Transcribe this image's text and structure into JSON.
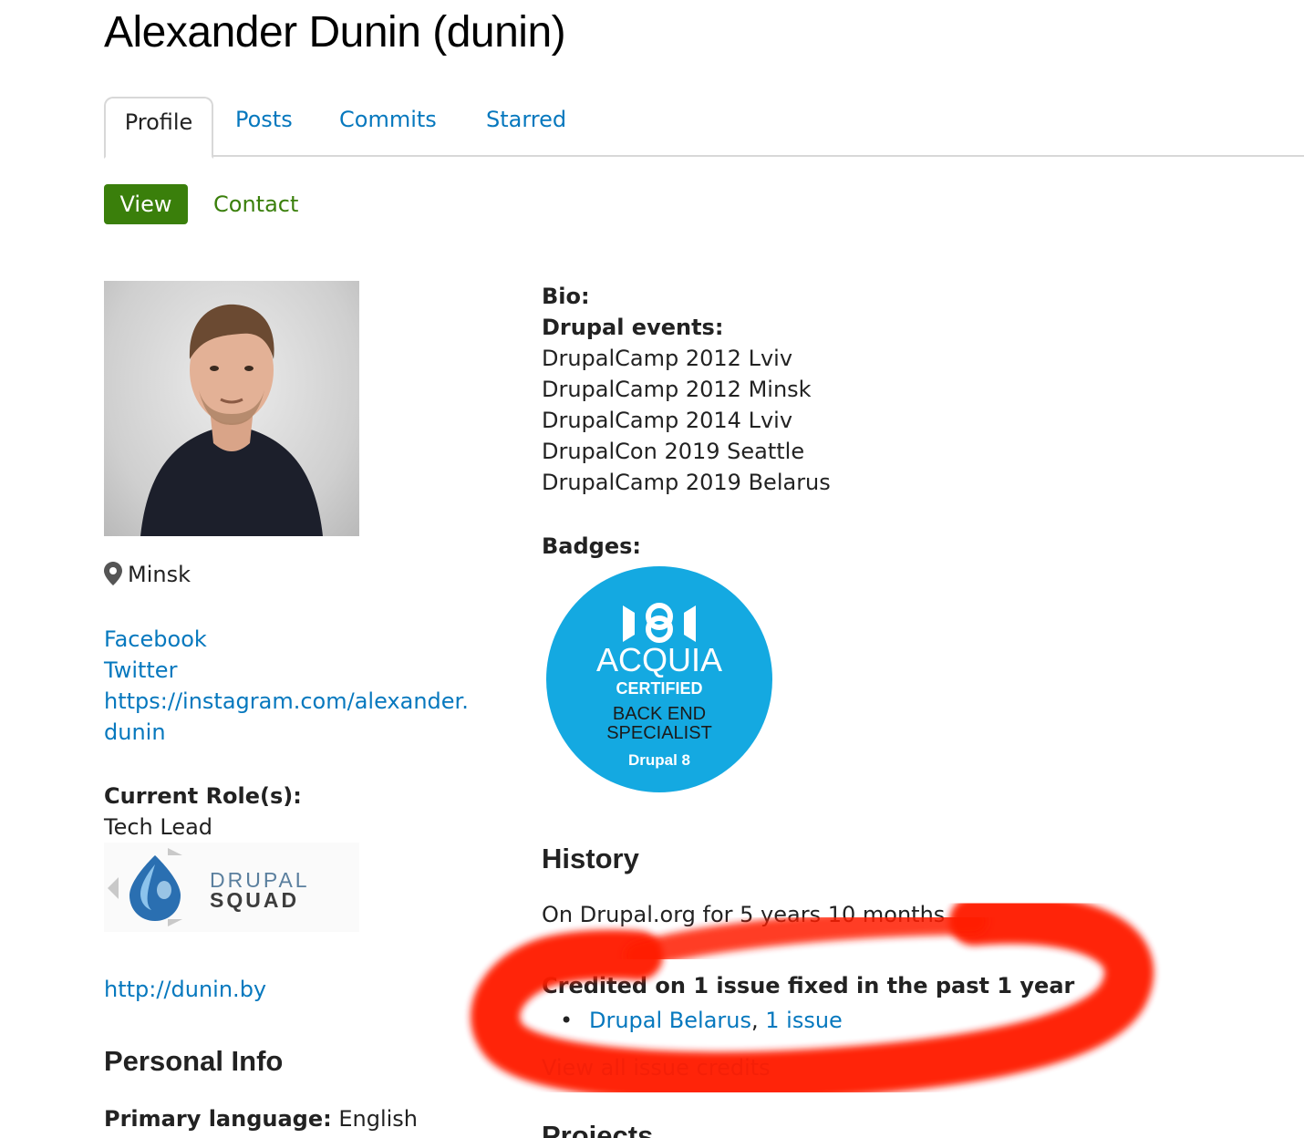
{
  "profile": {
    "title": "Alexander Dunin (dunin)"
  },
  "tabs": [
    {
      "label": "Profile",
      "active": true
    },
    {
      "label": "Posts"
    },
    {
      "label": "Commits"
    },
    {
      "label": "Starred"
    }
  ],
  "subtabs": {
    "view": "View",
    "contact": "Contact"
  },
  "sidebar": {
    "location": "Minsk",
    "links": {
      "facebook": "Facebook",
      "twitter": "Twitter",
      "instagram_line1": "https://instagram.com/alexander.",
      "instagram_line2": "dunin"
    },
    "role_label": "Current Role(s):",
    "role_value": "Tech Lead",
    "org_logo": {
      "line1": "DRUPAL",
      "line2": "SQUAD"
    },
    "website": "http://dunin.by",
    "personal_info_heading": "Personal Info",
    "primary_language_label": "Primary language:",
    "primary_language_value": "English"
  },
  "main": {
    "bio_label": "Bio:",
    "events_label": "Drupal events:",
    "events": [
      "DrupalCamp 2012 Lviv",
      "DrupalCamp 2012 Minsk",
      "DrupalCamp 2014 Lviv",
      "DrupalCon 2019 Seattle",
      "DrupalCamp 2019 Belarus"
    ],
    "badges_label": "Badges:",
    "badge": {
      "brand": "ACQUIA",
      "certified": "CERTIFIED",
      "line1": "BACK END",
      "line2": "SPECIALIST",
      "version": "Drupal 8",
      "color": "#14a9e1"
    },
    "history_heading": "History",
    "history_time": "On Drupal.org for 5 years 10 months",
    "credited": "Credited on 1 issue fixed in the past 1 year",
    "credit_org": "Drupal Belarus",
    "credit_sep": ",",
    "credit_count": "1 issue",
    "all_credits": "View all issue credits",
    "projects_heading": "Projects"
  },
  "colors": {
    "link": "#0678be",
    "active_green": "#3a7f0b",
    "annotation_red": "#ff1a00"
  }
}
